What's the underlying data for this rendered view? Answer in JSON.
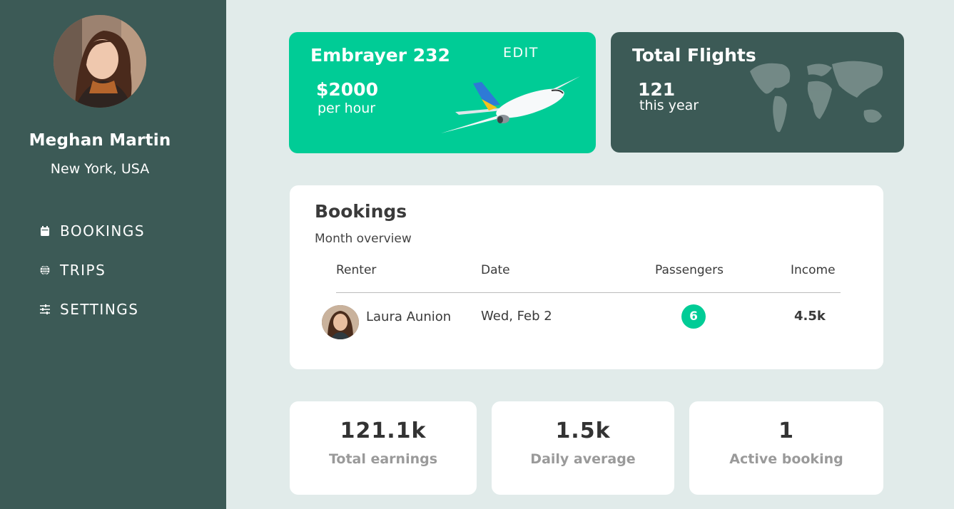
{
  "user": {
    "name": "Meghan Martin",
    "location": "New York, USA"
  },
  "nav": {
    "items": [
      {
        "label": "BOOKINGS",
        "icon": "calendar-icon"
      },
      {
        "label": "TRIPS",
        "icon": "globe-icon"
      },
      {
        "label": "SETTINGS",
        "icon": "sliders-icon"
      }
    ]
  },
  "plane_card": {
    "name": "Embrayer 232",
    "edit_label": "EDIT",
    "price": "$2000",
    "price_unit": "per hour",
    "icon": "airplane-image"
  },
  "flights_card": {
    "title": "Total Flights",
    "count": "121",
    "unit": "this year",
    "icon": "world-map-image"
  },
  "bookings": {
    "title": "Bookings",
    "subtitle": "Month overview",
    "columns": [
      "Renter",
      "Date",
      "Passengers",
      "Income"
    ],
    "rows": [
      {
        "renter": "Laura Aunion",
        "date": "Wed, Feb 2",
        "passengers": "6",
        "income": "4.5k"
      }
    ]
  },
  "stats": [
    {
      "value": "121.1k",
      "label": "Total earnings"
    },
    {
      "value": "1.5k",
      "label": "Daily average"
    },
    {
      "value": "1",
      "label": "Active booking"
    }
  ],
  "colors": {
    "sidebar": "#3c5a56",
    "accent": "#00cc96",
    "background": "#e1ebea"
  }
}
